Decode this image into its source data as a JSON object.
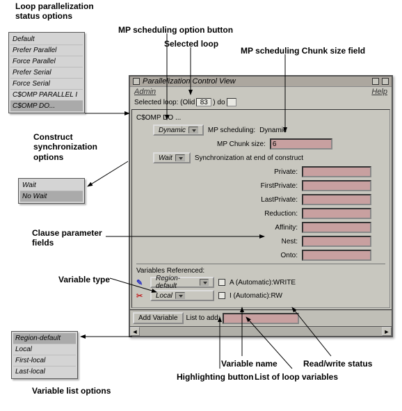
{
  "labels": {
    "loop_status": "Loop parallelization\nstatus options",
    "mp_button": "MP scheduling option button",
    "selected_loop": "Selected loop",
    "mp_chunk": "MP scheduling Chunk size field",
    "construct_sync": "Construct\nsynchronization\noptions",
    "clause_fields": "Clause parameter\nfields",
    "variable_type": "Variable type",
    "var_list_opt": "Variable list options",
    "highlight_btn": "Highlighting button",
    "var_name": "Variable name",
    "rw_status": "Read/write status",
    "loop_vars": "List of loop variables"
  },
  "status_options": [
    "Default",
    "Prefer Parallel",
    "Force Parallel",
    "Prefer Serial",
    "Force Serial",
    "C$OMP PARALLEL I",
    "C$OMP DO..."
  ],
  "sync_options": [
    "Wait",
    "No Wait"
  ],
  "varlist_options": [
    "Region-default",
    "Local",
    "First-local",
    "Last-local"
  ],
  "win": {
    "title": "Parallelization Control View",
    "admin": "Admin",
    "help": "Help",
    "selloop_prefix": "Selected loop: (Olid",
    "selloop_val": "83",
    "selloop_suffix": ") do",
    "header": "C$OMP DO ...",
    "dynamic": "Dynamic",
    "wait": "Wait",
    "mp_sched_label": "MP scheduling:",
    "mp_sched_val": "Dynamic",
    "chunk_label": "MP Chunk size:",
    "chunk_val": "6",
    "sync_label": "Synchronization at end of construct",
    "clauses": {
      "private": "Private:",
      "firstprivate": "FirstPrivate:",
      "lastprivate": "LastPrivate:",
      "reduction": "Reduction:",
      "affinity": "Affinity:",
      "nest": "Nest:",
      "onto": "Onto:"
    },
    "vars_header": "Variables Referenced:",
    "dd_region": "Region-default",
    "dd_local": "Local",
    "var_a": "A (Automatic):WRITE",
    "var_i": "I (Automatic):RW",
    "add_var": "Add Variable",
    "list_add": "List to add:"
  }
}
